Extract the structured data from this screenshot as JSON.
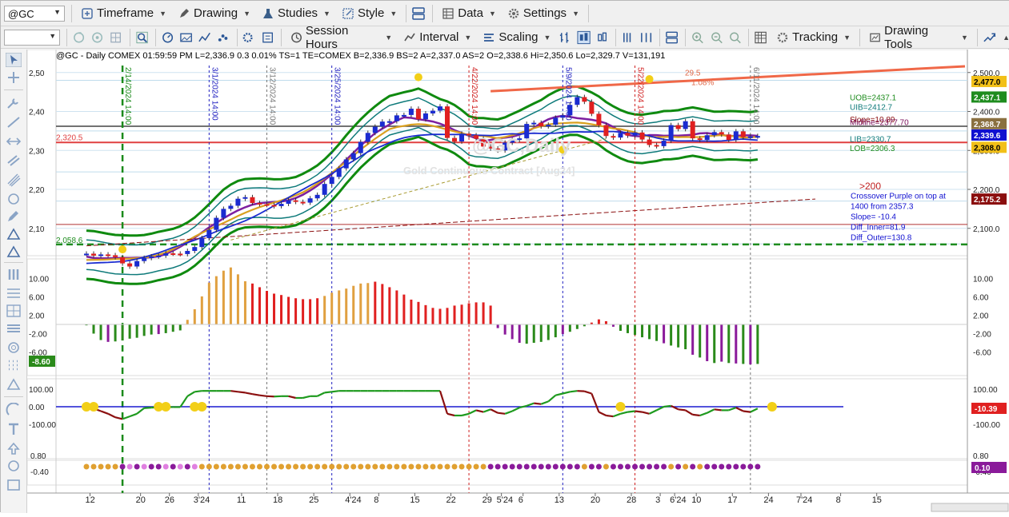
{
  "toolbar": {
    "symbol": "@GC",
    "timeframe": "Timeframe",
    "drawing": "Drawing",
    "studies": "Studies",
    "style": "Style",
    "data": "Data",
    "settings": "Settings",
    "session_hours": "Session Hours",
    "interval": "Interval",
    "scaling": "Scaling",
    "tracking": "Tracking",
    "drawing_tools": "Drawing Tools"
  },
  "chart": {
    "header": "@GC - Daily  COMEX  01:59:59 PM  L=2,336.9  0.3  0.01%  TS=1  TE=COMEX  B=2,336.9  BS=2  A=2,337.0  AS=2  O=2,338.6  Hi=2,350.6  Lo=2,329.7  V=131,191",
    "watermark_title": "@GC,Daily",
    "watermark_sub": "Gold Continuous Contract [Aug24]",
    "price_axis": [
      "2,500.0",
      "2,400.0",
      "2,300.0",
      "2,200.0",
      "2,100.0"
    ],
    "left_axis": [
      "2,50",
      "2,40",
      "2,30",
      "2,20",
      "2,10"
    ],
    "hline_label": "2,320.5",
    "low_label": "2,058.6",
    "price_badges": [
      {
        "text": "2,477.0",
        "color": "#f2c018",
        "fg": "#000000",
        "price": 2477
      },
      {
        "text": "2,437.1",
        "color": "#1e8c1e",
        "fg": "#ffffff",
        "price": 2437.1
      },
      {
        "text": "2,368.7",
        "color": "#8a7040",
        "fg": "#ffffff",
        "price": 2368.7
      },
      {
        "text": "2,339.6",
        "color": "#1010d0",
        "fg": "#ffffff",
        "price": 2339.6
      },
      {
        "text": "2,308.0",
        "color": "#f2c018",
        "fg": "#000000",
        "price": 2308
      },
      {
        "text": "2,175.2",
        "color": "#8b0f0f",
        "fg": "#ffffff",
        "price": 2175.2
      }
    ],
    "band_labels": [
      {
        "text": "UOB=2437.1",
        "color": "#1e8c1e",
        "price": 2437.1
      },
      {
        "text": "UIB=2412.7",
        "color": "#0e7a7a",
        "price": 2412.7
      },
      {
        "text": "Slope=10.89",
        "color": "#8b0f0f",
        "price": 2381
      },
      {
        "text": "Midline=2377.70",
        "color": "#7a0f5a",
        "price": 2373
      },
      {
        "text": "LIB=2330.7",
        "color": "#0e7a7a",
        "price": 2330.7
      },
      {
        "text": "LOB=2306.3",
        "color": "#1e8c1e",
        "price": 2306.3
      }
    ],
    "annotations": {
      "pct_value": "29.5",
      "pct_change": "1.08%",
      "ma_label": ">200",
      "crossover_lines": [
        "Crossover Purple on top at",
        "1400 from 2357.3",
        "Slope= -10.4",
        "Diff_Inner=81.9",
        "Diff_Outer=130.8"
      ]
    },
    "vlines": [
      {
        "label": "2/14/2024 14:00",
        "color": "#1a8a1a"
      },
      {
        "label": "3/1/2024 14:00",
        "color": "#2020c0"
      },
      {
        "label": "3/12/2024 14:00",
        "color": "#777777"
      },
      {
        "label": "3/25/2024 14:00",
        "color": "#2020c0"
      },
      {
        "label": "4/22/2024 14:00",
        "color": "#d02020"
      },
      {
        "label": "5/9/2024 14:00",
        "color": "#2020c0"
      },
      {
        "label": "5/22/2024 14:00",
        "color": "#d02020"
      },
      {
        "label": "6/11/2024 14:00",
        "color": "#777777"
      }
    ],
    "osc_axis": [
      "10.00",
      "6.00",
      "2.00",
      "-2.00",
      "-6.00"
    ],
    "osc_badge": "-8.60",
    "mom_axis": [
      "100.00",
      "0.00",
      "-100.00"
    ],
    "mom_badge": "-10.39",
    "dot_axis": [
      "0.80",
      "-0.40"
    ],
    "dot_badge": "0.10",
    "date_axis": [
      {
        "text": "12",
        "pos": 0.5
      },
      {
        "text": "20",
        "pos": 7.5
      },
      {
        "text": "26",
        "pos": 11.5
      },
      {
        "text": "3'24",
        "pos": 15.5
      },
      {
        "text": "11",
        "pos": 21.5
      },
      {
        "text": "18",
        "pos": 26.5
      },
      {
        "text": "25",
        "pos": 31.5
      },
      {
        "text": "4'24",
        "pos": 36.5
      },
      {
        "text": "8",
        "pos": 40.5
      },
      {
        "text": "15",
        "pos": 45.5
      },
      {
        "text": "22",
        "pos": 50.5
      },
      {
        "text": "29",
        "pos": 55.5
      },
      {
        "text": "5'24",
        "pos": 57.5
      },
      {
        "text": "6",
        "pos": 60.5
      },
      {
        "text": "13",
        "pos": 65.5
      },
      {
        "text": "20",
        "pos": 70.5
      },
      {
        "text": "28",
        "pos": 75.5
      },
      {
        "text": "3",
        "pos": 79.5
      },
      {
        "text": "6'24",
        "pos": 81.5
      },
      {
        "text": "10",
        "pos": 84.5
      },
      {
        "text": "17",
        "pos": 89.5
      },
      {
        "text": "24",
        "pos": 94.5
      },
      {
        "text": "7'24",
        "pos": 99
      },
      {
        "text": "8",
        "pos": 104.5
      },
      {
        "text": "15",
        "pos": 109.5
      }
    ]
  },
  "chart_data": {
    "type": "candlestick",
    "title": "@GC - Daily",
    "x_unit": "trading day index (starting 2/8/2024)",
    "ylim": [
      2040,
      2520
    ],
    "close": [
      2035,
      2030,
      2033,
      2031,
      2026,
      2010,
      2002,
      2016,
      2024,
      2028,
      2030,
      2036,
      2035,
      2034,
      2042,
      2052,
      2075,
      2096,
      2127,
      2150,
      2158,
      2176,
      2180,
      2165,
      2162,
      2160,
      2157,
      2163,
      2172,
      2168,
      2166,
      2177,
      2186,
      2214,
      2232,
      2254,
      2277,
      2293,
      2322,
      2345,
      2361,
      2374,
      2375,
      2390,
      2391,
      2407,
      2380,
      2395,
      2402,
      2413,
      2332,
      2323,
      2343,
      2339,
      2330,
      2310,
      2305,
      2300,
      2320,
      2327,
      2331,
      2368,
      2371,
      2362,
      2366,
      2384,
      2390,
      2417,
      2437,
      2425,
      2394,
      2365,
      2337,
      2333,
      2345,
      2338,
      2346,
      2328,
      2314,
      2311,
      2325,
      2365,
      2355,
      2375,
      2331,
      2327,
      2339,
      2347,
      2341,
      2327,
      2349,
      2334,
      2336,
      2337
    ],
    "moving_average_200": [
      2055,
      2175.2
    ],
    "bands": {
      "UOB": 2437.1,
      "UIB": 2412.7,
      "Midline": 2377.7,
      "LIB": 2330.7,
      "LOB": 2306.3
    },
    "horizontal_lines": [
      2320.5,
      2058.6
    ],
    "histogram": {
      "y_range": [
        -9,
        12
      ],
      "values": [
        -0.2,
        -2.0,
        -3.4,
        -3.8,
        -3.7,
        -3.5,
        -3.1,
        -2.9,
        -2.5,
        -2.2,
        -2.1,
        -1.9,
        -1.6,
        -1.3,
        1.0,
        3.3,
        6.1,
        9.1,
        10.5,
        11.7,
        12.4,
        10.9,
        9.4,
        8.9,
        8.1,
        7.3,
        6.7,
        6.4,
        6.0,
        5.7,
        5.5,
        5.5,
        5.7,
        6.2,
        6.9,
        7.4,
        7.8,
        8.4,
        8.9,
        9.0,
        9.3,
        8.8,
        8.1,
        7.4,
        6.5,
        5.4,
        4.9,
        4.2,
        3.6,
        3.4,
        3.6,
        4.1,
        4.3,
        4.6,
        4.8,
        4.8,
        4.1,
        -0.8,
        -2.2,
        -3.2,
        -4.0,
        -4.2,
        -4.0,
        -3.8,
        -3.4,
        -2.8,
        -2.1,
        -1.6,
        -1.0,
        -0.4,
        0.4,
        1.1,
        0.7,
        -0.5,
        -1.4,
        -1.9,
        -2.3,
        -2.8,
        -3.2,
        -3.6,
        -4.1,
        -4.6,
        -5.0,
        -5.4,
        -6.6,
        -7.2,
        -8.0,
        -8.4,
        -8.1,
        -8.4,
        -8.5,
        -8.6,
        -8.7,
        -8.6
      ]
    },
    "momentum": {
      "y_range": [
        -150,
        150
      ],
      "values": [
        -8,
        -10,
        -25,
        -40,
        -60,
        -70,
        -55,
        -40,
        -8,
        -5,
        -3,
        -2,
        -2,
        -2,
        60,
        85,
        90,
        90,
        90,
        90,
        90,
        85,
        80,
        72,
        65,
        60,
        58,
        60,
        60,
        50,
        50,
        60,
        60,
        80,
        85,
        90,
        90,
        90,
        90,
        90,
        90,
        90,
        90,
        90,
        90,
        90,
        90,
        90,
        90,
        90,
        -40,
        -50,
        -50,
        -40,
        -20,
        -30,
        -15,
        -35,
        -40,
        -25,
        -5,
        5,
        20,
        15,
        30,
        65,
        75,
        85,
        90,
        88,
        75,
        -30,
        -50,
        -55,
        -40,
        -30,
        -25,
        -30,
        -40,
        -20,
        0,
        5,
        -15,
        -20,
        -45,
        -50,
        -35,
        -15,
        -20,
        -20,
        -5,
        -25,
        -30,
        -10
      ]
    },
    "dots": {
      "row_value": 0.1,
      "count": 94
    }
  }
}
